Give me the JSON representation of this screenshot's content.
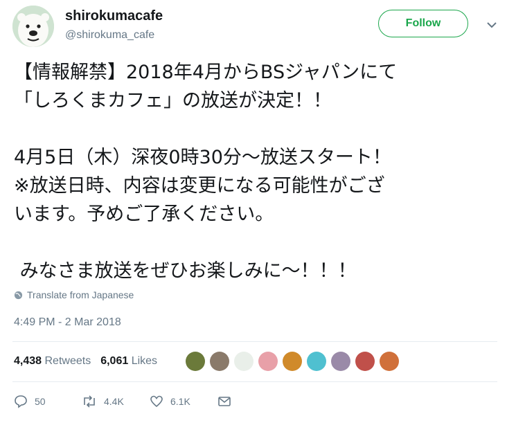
{
  "account": {
    "name": "shirokumacafe",
    "handle": "@shirokuma_cafe",
    "avatar_icon": "polar-bear-avatar"
  },
  "follow_label": "Follow",
  "accent_color": "#1aa64b",
  "tweet": {
    "lines": [
      "【情報解禁】2018年4月からBSジャパンにて",
      "「しろくまカフェ」の放送が決定！！",
      "",
      "4月5日（木）深夜0時30分～放送スタート！",
      "※放送日時、内容は変更になる可能性がござ",
      "います。予めご了承ください。",
      "",
      " みなさま放送をぜひお楽しみに～！！！"
    ]
  },
  "translate_label": "Translate from Japanese",
  "timestamp": "4:49 PM - 2 Mar 2018",
  "stats": {
    "retweets_count": "4,438",
    "retweets_label": "Retweets",
    "likes_count": "6,061",
    "likes_label": "Likes"
  },
  "likers": [
    {
      "name": "liker-avatar-1",
      "color": "#6b7a3a"
    },
    {
      "name": "liker-avatar-2",
      "color": "#8a7a6a"
    },
    {
      "name": "liker-avatar-3",
      "color": "#e9efe9"
    },
    {
      "name": "liker-avatar-4",
      "color": "#e8a0a8"
    },
    {
      "name": "liker-avatar-5",
      "color": "#d08a2a"
    },
    {
      "name": "liker-avatar-6",
      "color": "#4fc0d0"
    },
    {
      "name": "liker-avatar-7",
      "color": "#9a8aa8"
    },
    {
      "name": "liker-avatar-8",
      "color": "#c0504a"
    },
    {
      "name": "liker-avatar-9",
      "color": "#d0703a"
    }
  ],
  "actions": {
    "replies": "50",
    "retweets": "4.4K",
    "likes": "6.1K"
  }
}
